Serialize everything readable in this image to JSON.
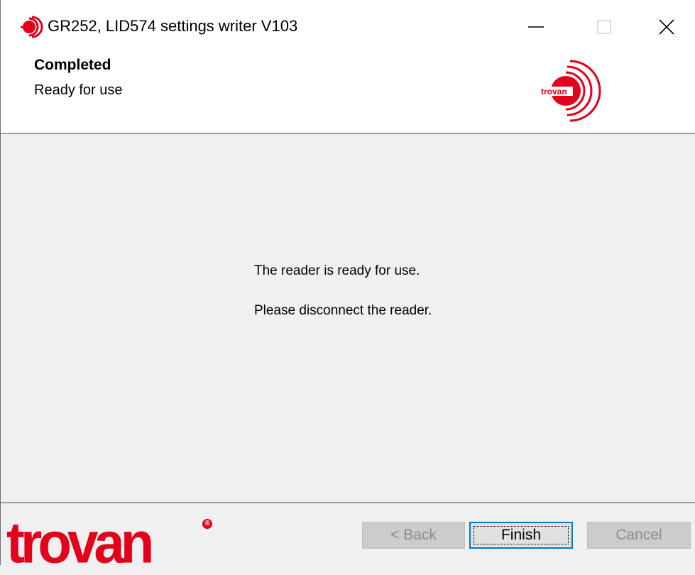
{
  "window": {
    "title": "GR252, LID574 settings writer V103"
  },
  "header": {
    "title": "Completed",
    "subtitle": "Ready for use",
    "logo_text": "trovan"
  },
  "main": {
    "message1": "The reader is ready for use.",
    "message2": "Please disconnect the reader."
  },
  "footer": {
    "logo_text": "trovan",
    "buttons": {
      "back": "< Back",
      "finish": "Finish",
      "cancel": "Cancel"
    }
  },
  "colors": {
    "brand_red": "#e2001a",
    "focus_blue": "#0078d7"
  }
}
